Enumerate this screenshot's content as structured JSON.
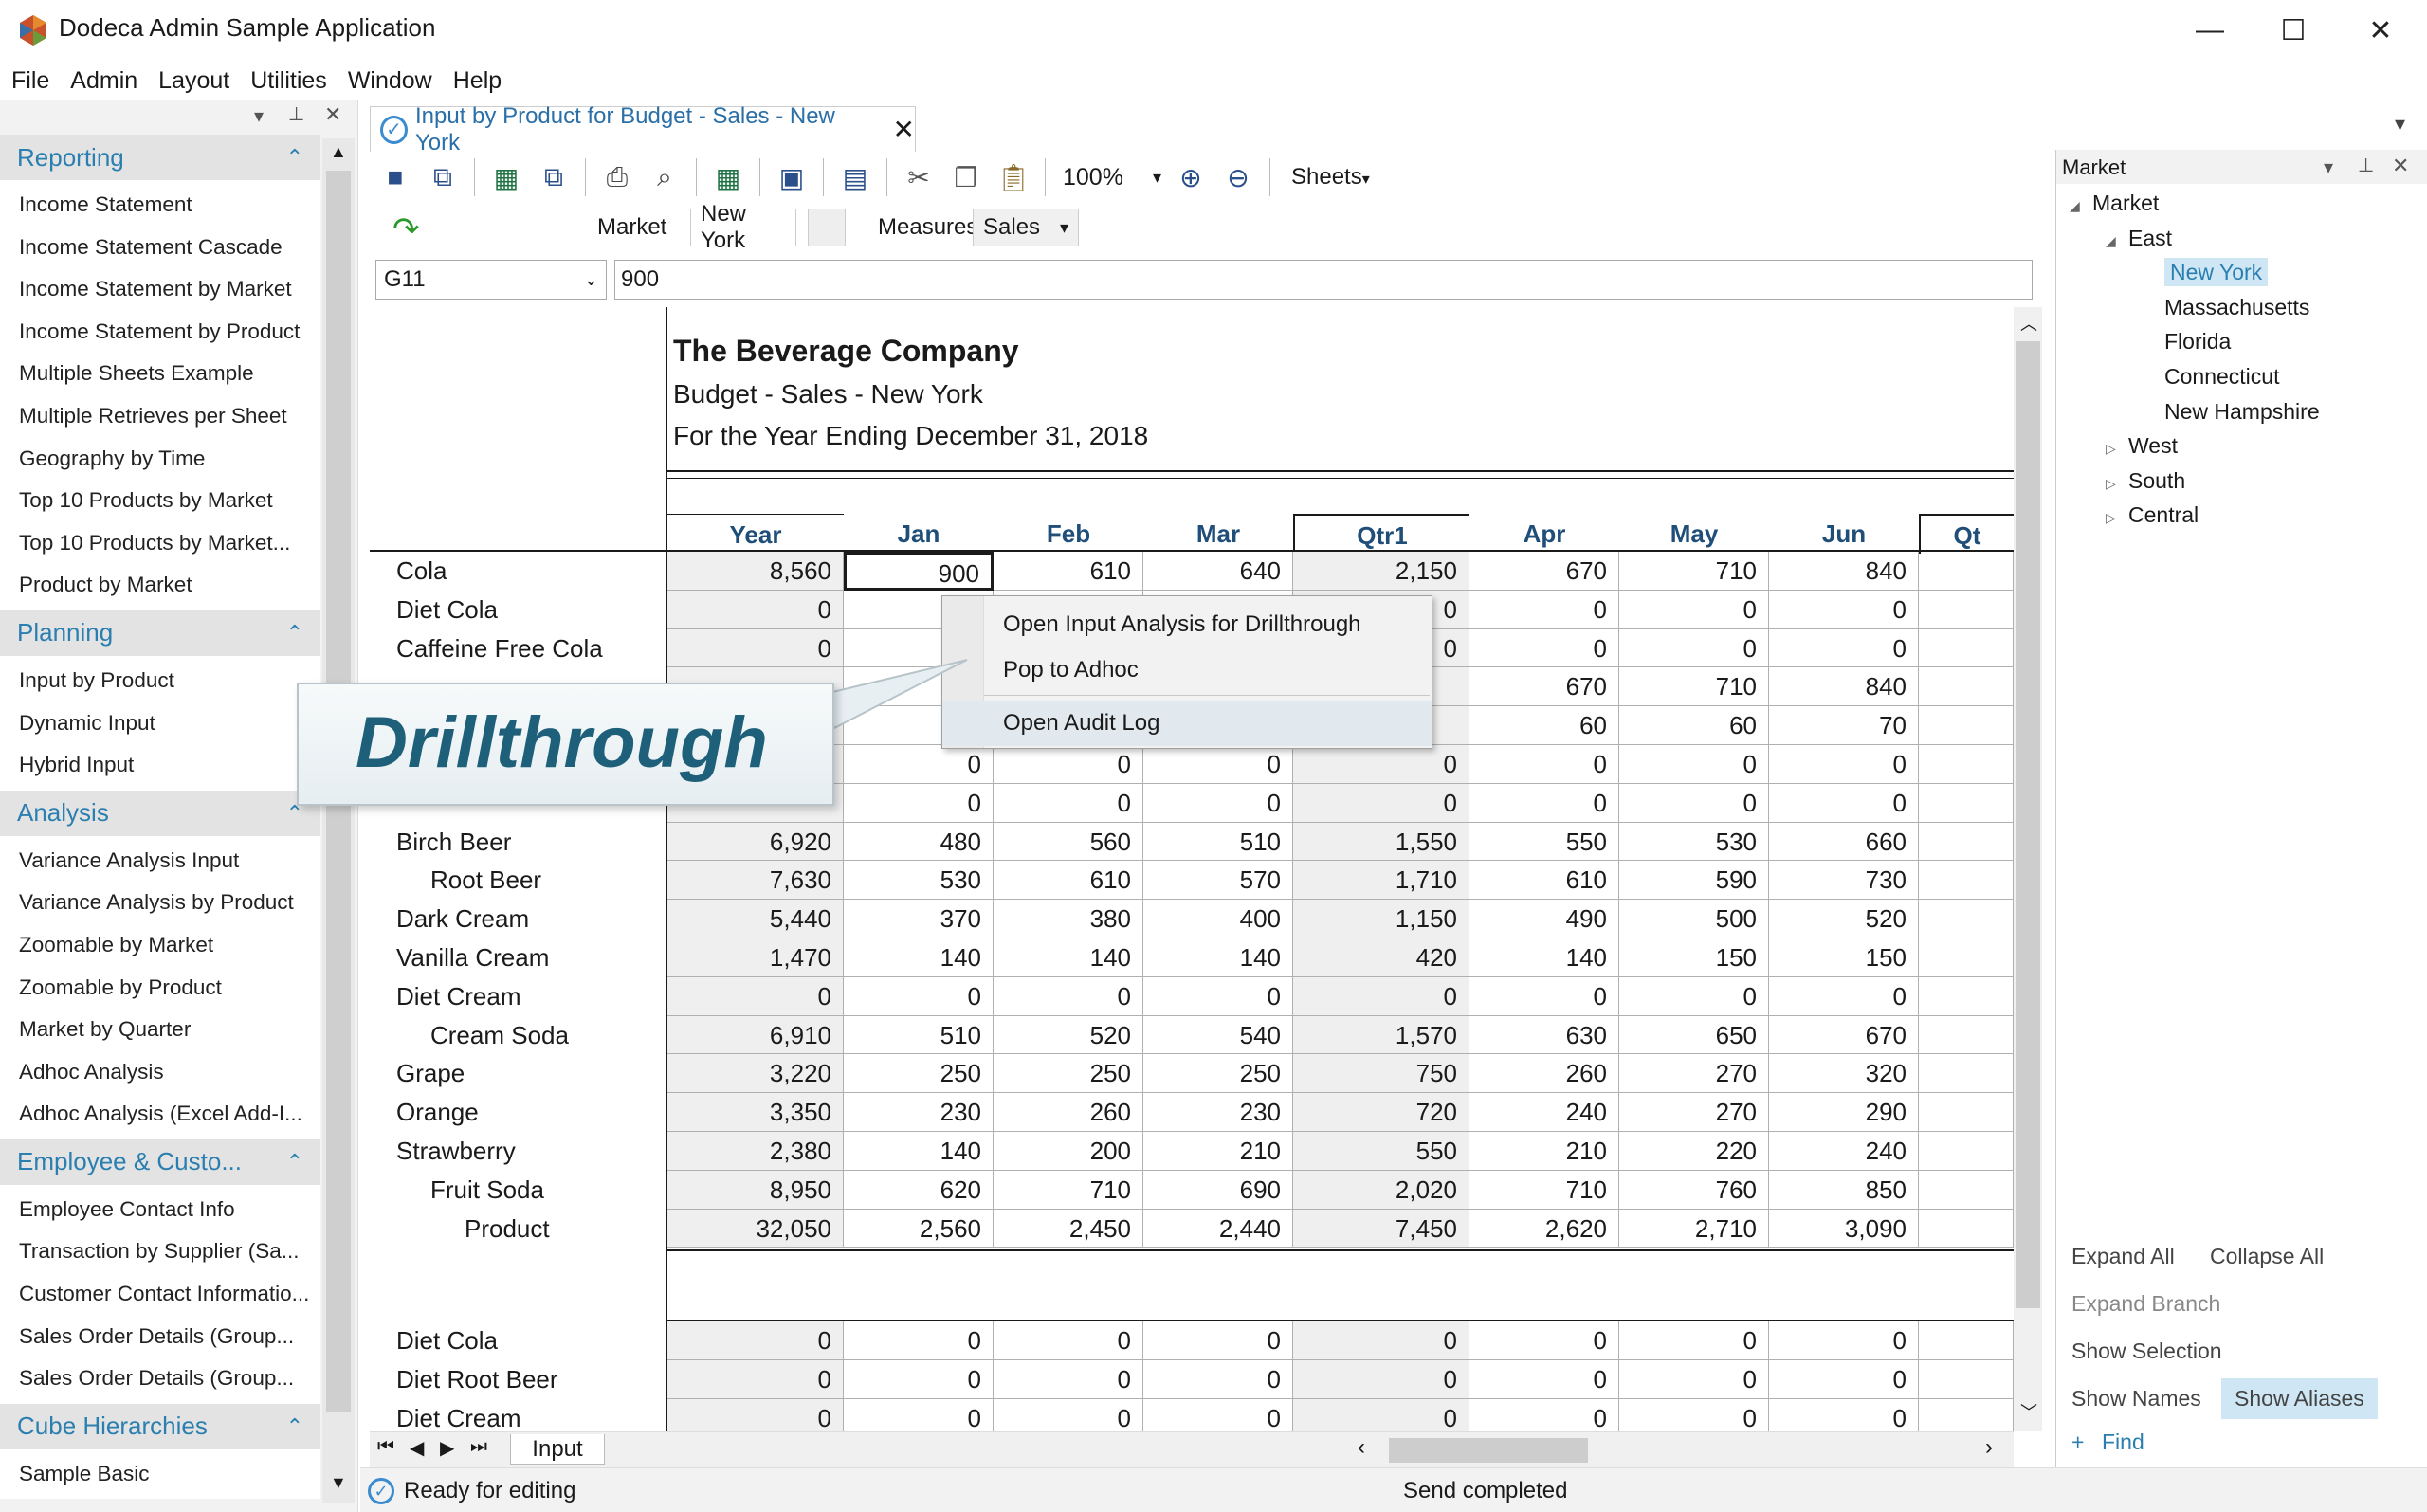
{
  "window": {
    "title": "Dodeca Admin Sample Application",
    "controls": {
      "minimize": "—",
      "maximize": "☐",
      "close": "✕"
    }
  },
  "menu": [
    "File",
    "Admin",
    "Layout",
    "Utilities",
    "Window",
    "Help"
  ],
  "nav": {
    "sections": [
      {
        "title": "Reporting",
        "items": [
          "Income Statement",
          "Income Statement Cascade",
          "Income Statement by Market",
          "Income Statement by Product",
          "Multiple Sheets Example",
          "Multiple Retrieves per Sheet",
          "Geography by Time",
          "Top 10 Products by Market",
          "Top 10 Products by Market...",
          "Product by Market"
        ]
      },
      {
        "title": "Planning",
        "items": [
          "Input by Product",
          "Dynamic Input",
          "Hybrid Input"
        ]
      },
      {
        "title": "Analysis",
        "items": [
          "Variance Analysis Input",
          "Variance Analysis by Product",
          "Zoomable by Market",
          "Zoomable by Product",
          "Market by Quarter",
          "Adhoc Analysis",
          "Adhoc Analysis (Excel Add-I..."
        ]
      },
      {
        "title": "Employee  &  Custo...",
        "items": [
          "Employee Contact Info",
          "Transaction by Supplier (Sa...",
          "Customer Contact Informatio...",
          "Sales Order Details (Group...",
          "Sales Order Details (Group..."
        ]
      },
      {
        "title": "Cube Hierarchies",
        "items": [
          "Sample Basic"
        ]
      }
    ]
  },
  "doc_tab": {
    "label": "Input by Product for Budget - Sales - New York"
  },
  "toolbar": {
    "zoom": "100%",
    "sheets_label": "Sheets"
  },
  "pov": {
    "market_label": "Market",
    "market_value": "New York",
    "measures_label": "Measures",
    "measures_value": "Sales"
  },
  "formula": {
    "cell_ref": "G11",
    "value": "900"
  },
  "report": {
    "company": "The Beverage Company",
    "subtitle1": "Budget - Sales - New York",
    "subtitle2": "For the Year Ending December 31, 2018",
    "columns": [
      "Year",
      "Jan",
      "Feb",
      "Mar",
      "Qtr1",
      "Apr",
      "May",
      "Jun",
      "Qt"
    ],
    "rows": [
      {
        "label": "Cola",
        "indent": 0,
        "values": [
          "8,560",
          "900",
          "610",
          "640",
          "2,150",
          "670",
          "710",
          "840"
        ]
      },
      {
        "label": "Diet Cola",
        "indent": 0,
        "values": [
          "0",
          "",
          "",
          "",
          "0",
          "0",
          "0",
          "0"
        ]
      },
      {
        "label": "Caffeine Free Cola",
        "indent": 0,
        "values": [
          "0",
          "",
          "",
          "",
          "0",
          "0",
          "0",
          "0"
        ]
      },
      {
        "label": "",
        "indent": 0,
        "values": [
          "",
          "",
          "",
          "",
          "",
          "670",
          "710",
          "840"
        ]
      },
      {
        "label": "",
        "indent": 0,
        "values": [
          "",
          "",
          "",
          "",
          "",
          "60",
          "60",
          "70"
        ]
      },
      {
        "label": "",
        "indent": 0,
        "values": [
          "",
          "0",
          "0",
          "0",
          "0",
          "0",
          "0",
          "0"
        ]
      },
      {
        "label": "",
        "indent": 0,
        "values": [
          "",
          "0",
          "0",
          "0",
          "0",
          "0",
          "0",
          "0"
        ]
      },
      {
        "label": "Birch Beer",
        "indent": 0,
        "values": [
          "6,920",
          "480",
          "560",
          "510",
          "1,550",
          "550",
          "530",
          "660"
        ]
      },
      {
        "label": "Root Beer",
        "indent": 1,
        "values": [
          "7,630",
          "530",
          "610",
          "570",
          "1,710",
          "610",
          "590",
          "730"
        ]
      },
      {
        "label": "Dark Cream",
        "indent": 0,
        "values": [
          "5,440",
          "370",
          "380",
          "400",
          "1,150",
          "490",
          "500",
          "520"
        ]
      },
      {
        "label": "Vanilla Cream",
        "indent": 0,
        "values": [
          "1,470",
          "140",
          "140",
          "140",
          "420",
          "140",
          "150",
          "150"
        ]
      },
      {
        "label": "Diet Cream",
        "indent": 0,
        "values": [
          "0",
          "0",
          "0",
          "0",
          "0",
          "0",
          "0",
          "0"
        ]
      },
      {
        "label": "Cream Soda",
        "indent": 1,
        "values": [
          "6,910",
          "510",
          "520",
          "540",
          "1,570",
          "630",
          "650",
          "670"
        ]
      },
      {
        "label": "Grape",
        "indent": 0,
        "values": [
          "3,220",
          "250",
          "250",
          "250",
          "750",
          "260",
          "270",
          "320"
        ]
      },
      {
        "label": "Orange",
        "indent": 0,
        "values": [
          "3,350",
          "230",
          "260",
          "230",
          "720",
          "240",
          "270",
          "290"
        ]
      },
      {
        "label": "Strawberry",
        "indent": 0,
        "values": [
          "2,380",
          "140",
          "200",
          "210",
          "550",
          "210",
          "220",
          "240"
        ]
      },
      {
        "label": "Fruit Soda",
        "indent": 1,
        "values": [
          "8,950",
          "620",
          "710",
          "690",
          "2,020",
          "710",
          "760",
          "850"
        ]
      },
      {
        "label": "Product",
        "indent": 2,
        "values": [
          "32,050",
          "2,560",
          "2,450",
          "2,440",
          "7,450",
          "2,620",
          "2,710",
          "3,090"
        ]
      }
    ],
    "rows2": [
      {
        "label": "Diet Cola",
        "values": [
          "0",
          "0",
          "0",
          "0",
          "0",
          "0",
          "0",
          "0"
        ]
      },
      {
        "label": "Diet Root Beer",
        "values": [
          "0",
          "0",
          "0",
          "0",
          "0",
          "0",
          "0",
          "0"
        ]
      },
      {
        "label": "Diet Cream",
        "values": [
          "0",
          "0",
          "0",
          "0",
          "0",
          "0",
          "0",
          "0"
        ]
      }
    ],
    "sheet_tab": "Input"
  },
  "context_menu": [
    "Open Input Analysis for Drillthrough",
    "Pop to Adhoc",
    "Open Audit Log"
  ],
  "callout": "Drillthrough",
  "market_panel": {
    "title": "Market",
    "tree": [
      {
        "label": "Market",
        "depth": 0,
        "expander": "◢"
      },
      {
        "label": "East",
        "depth": 1,
        "expander": "◢"
      },
      {
        "label": "New York",
        "depth": 2,
        "expander": "",
        "selected": true
      },
      {
        "label": "Massachusetts",
        "depth": 2,
        "expander": ""
      },
      {
        "label": "Florida",
        "depth": 2,
        "expander": ""
      },
      {
        "label": "Connecticut",
        "depth": 2,
        "expander": ""
      },
      {
        "label": "New Hampshire",
        "depth": 2,
        "expander": ""
      },
      {
        "label": "West",
        "depth": 1,
        "expander": "▷"
      },
      {
        "label": "South",
        "depth": 1,
        "expander": "▷"
      },
      {
        "label": "Central",
        "depth": 1,
        "expander": "▷"
      }
    ],
    "buttons": {
      "expand_all": "Expand All",
      "collapse_all": "Collapse All",
      "expand_branch": "Expand Branch",
      "show_selection": "Show Selection",
      "show_names": "Show Names",
      "show_aliases": "Show Aliases",
      "find": "Find"
    }
  },
  "status": {
    "left": "Ready for editing",
    "right": "Send completed"
  }
}
